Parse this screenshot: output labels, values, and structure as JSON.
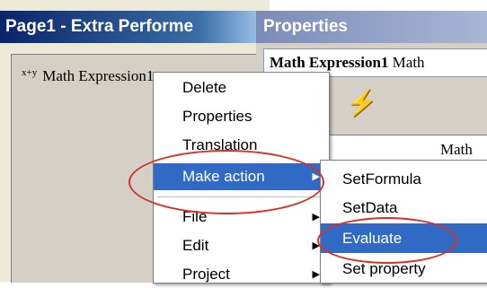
{
  "left_window": {
    "title": "Page1 - Extra Performe",
    "node": {
      "icon": "x+y",
      "label": "Math Expression1"
    }
  },
  "right_window": {
    "title": "Properties",
    "combo": {
      "bold": "Math Expression1",
      "rest": "Math"
    },
    "grid": {
      "column_header": "Math"
    },
    "toolbar": {
      "icon": "lightning-icon"
    }
  },
  "context_menu": {
    "items": [
      {
        "label": "Delete"
      },
      {
        "label": "Properties"
      },
      {
        "label": "Translation"
      },
      {
        "label": "Make action",
        "submenu": true,
        "selected": true
      },
      {
        "label": "File",
        "submenu": true
      },
      {
        "label": "Edit",
        "submenu": true
      },
      {
        "label": "Project",
        "submenu": true
      }
    ]
  },
  "submenu": {
    "items": [
      {
        "label": "SetFormula"
      },
      {
        "label": "SetData"
      },
      {
        "label": "Evaluate",
        "selected": true
      },
      {
        "label": "Set property"
      }
    ]
  },
  "highlight_color": "#d8302a",
  "selection_color": "#316ac5"
}
